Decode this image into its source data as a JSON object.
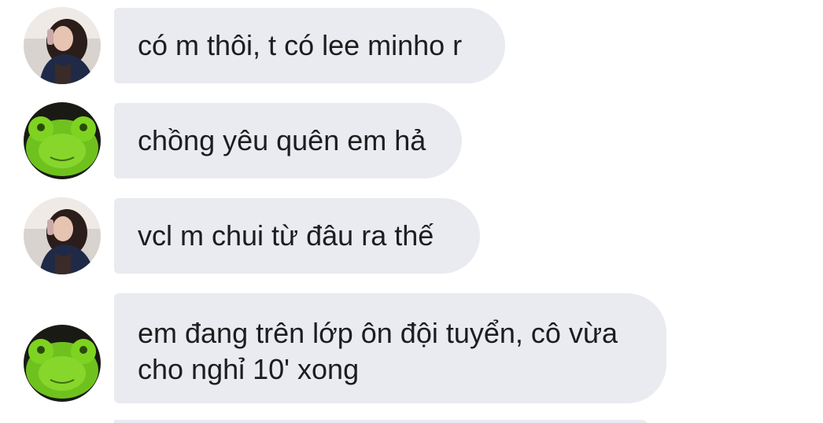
{
  "messages": [
    {
      "sender": "girl-avatar",
      "text": "có m thôi, t có lee minho r"
    },
    {
      "sender": "frog-avatar",
      "text": "chồng yêu quên em hả"
    },
    {
      "sender": "girl-avatar",
      "text": "vcl m chui từ đâu ra thế"
    },
    {
      "sender": "frog-avatar",
      "lines": [
        "em đang trên lớp ôn đội tuyển, cô vừa",
        "cho nghỉ 10' xong"
      ]
    }
  ],
  "colors": {
    "bubble": "#e9ebf0",
    "text": "#1d1d1f",
    "background": "#ffffff"
  }
}
